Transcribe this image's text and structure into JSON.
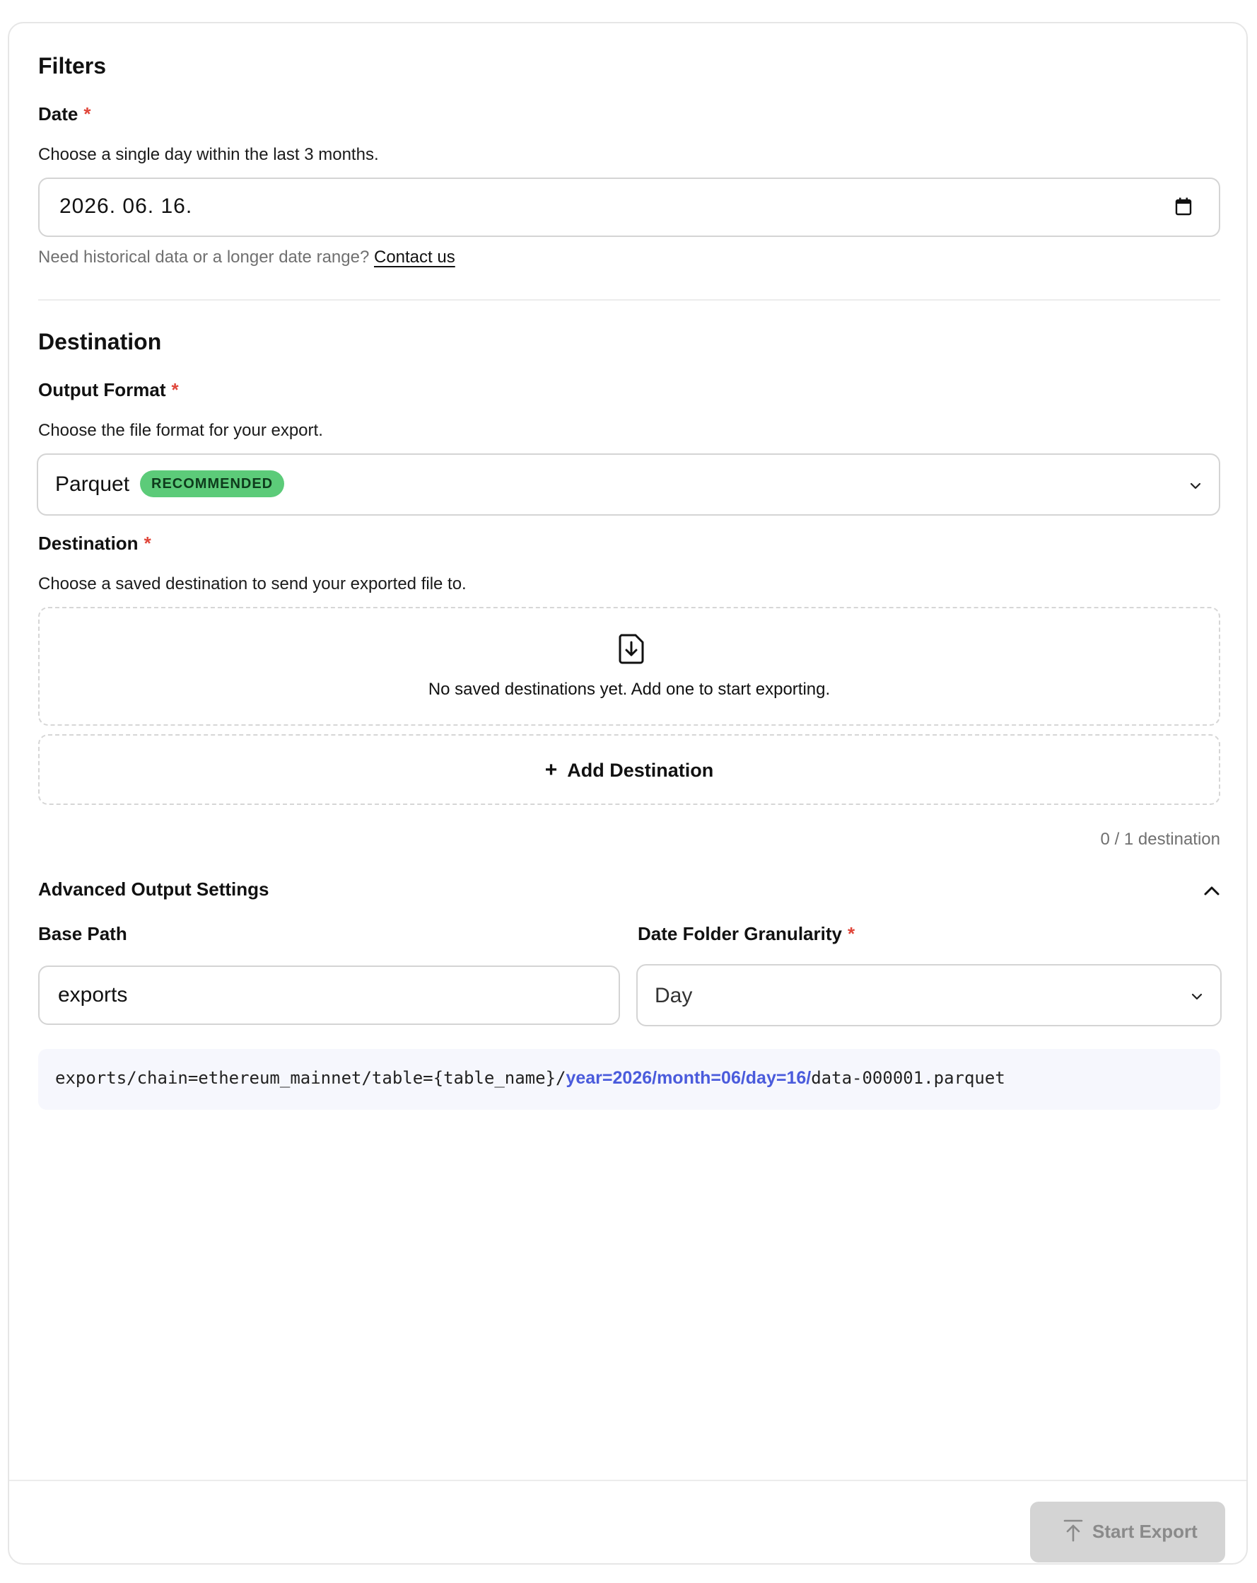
{
  "filters": {
    "title": "Filters",
    "date": {
      "label": "Date",
      "required_mark": "*",
      "help": "Choose a single day within the last 3 months.",
      "value": "2026. 06. 16.",
      "note": "Need historical data or a longer date range?",
      "contact_link": "Contact us"
    }
  },
  "destination_section": {
    "title": "Destination",
    "output_format": {
      "label": "Output Format",
      "required_mark": "*",
      "help": "Choose the file format for your export.",
      "selected": "Parquet",
      "badge": "RECOMMENDED"
    },
    "destination": {
      "label": "Destination",
      "required_mark": "*",
      "help": "Choose a saved destination to send your exported file to.",
      "empty_message": "No saved destinations yet. Add one to start exporting.",
      "add_label": "Add Destination",
      "add_symbol": "+",
      "count": "0 / 1 destination"
    }
  },
  "advanced": {
    "title": "Advanced Output Settings",
    "base_path": {
      "label": "Base Path",
      "value": "exports"
    },
    "granularity": {
      "label": "Date Folder Granularity",
      "required_mark": "*",
      "selected": "Day"
    },
    "preview": {
      "prefix": "exports/chain=ethereum_mainnet/table={table_name}/",
      "highlight": "year=2026/month=06/day=16/",
      "suffix": "data-000001.parquet"
    }
  },
  "footer": {
    "start_export_label": "Start Export"
  },
  "colors": {
    "required": "#e0463a",
    "badge_bg": "#5ccb79",
    "path_highlight": "#4a5bdc",
    "disabled_button": "#d4d4d4"
  },
  "icons": {
    "date": "calendar-icon",
    "dropdown": "chevron-down-icon",
    "empty": "file-download-icon",
    "add": "plus-icon",
    "collapse": "chevron-up-icon",
    "export": "upload-icon"
  }
}
